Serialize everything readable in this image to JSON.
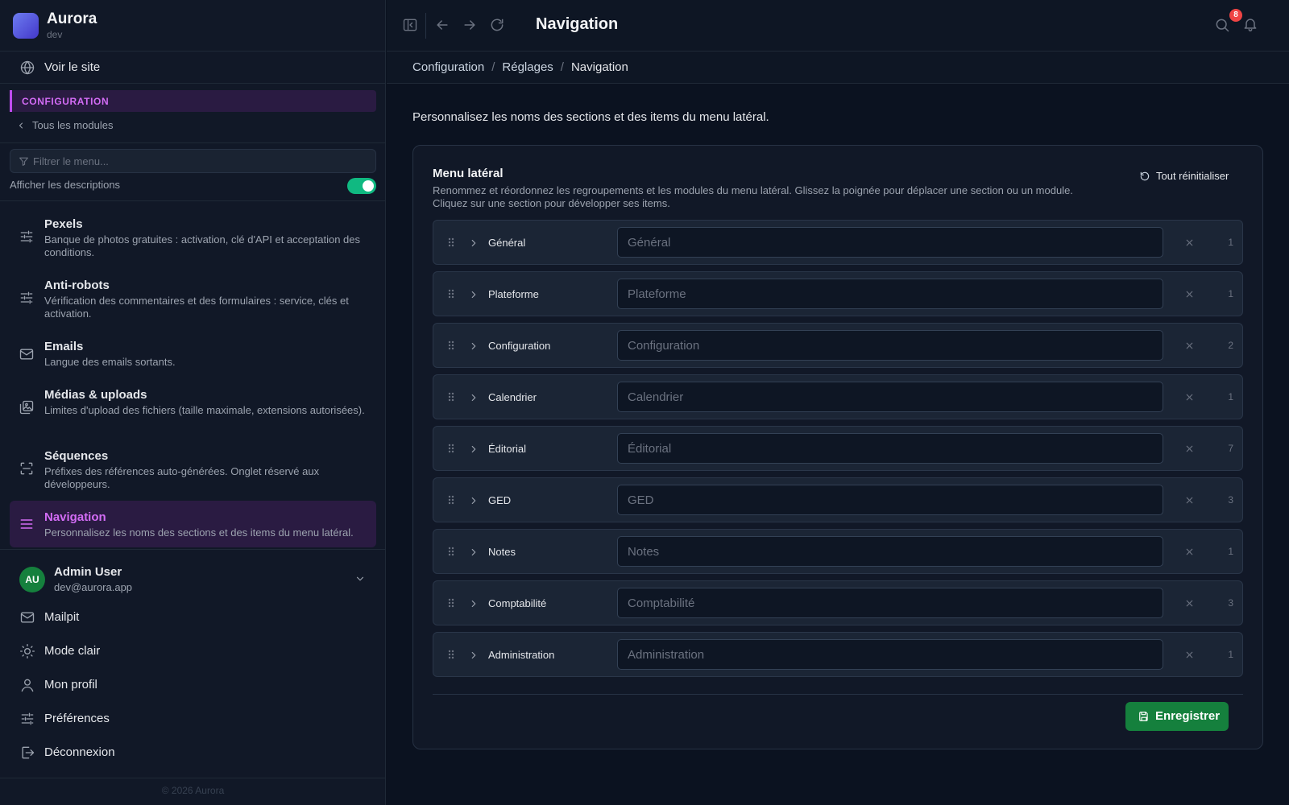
{
  "brand": {
    "name": "Aurora",
    "env": "dev"
  },
  "sidebar": {
    "view_site": "Voir le site",
    "section_title": "CONFIGURATION",
    "all_modules": "Tous les modules",
    "filter_placeholder": "Filtrer le menu...",
    "descriptions_toggle": {
      "label": "Afficher les descriptions",
      "on": true
    },
    "items": [
      {
        "title": "Pexels",
        "desc": "Banque de photos gratuites : activation, clé d'API et acceptation des conditions.",
        "icon": "sliders-icon"
      },
      {
        "title": "Anti-robots",
        "desc": "Vérification des commentaires et des formulaires : service, clés et activation.",
        "icon": "sliders-icon"
      },
      {
        "title": "Emails",
        "desc": "Langue des emails sortants.",
        "icon": "mail-icon"
      },
      {
        "title": "Médias & uploads",
        "desc": "Limites d'upload des fichiers (taille maximale, extensions autorisées).",
        "icon": "images-icon"
      },
      {
        "title": "Séquences",
        "desc": "Préfixes des références auto-générées. Onglet réservé aux développeurs.",
        "icon": "scan-icon"
      },
      {
        "title": "Navigation",
        "desc": "Personnalisez les noms des sections et des items du menu latéral.",
        "icon": "menu-icon",
        "active": true
      }
    ],
    "user": {
      "initials": "AU",
      "name": "Admin User",
      "email": "dev@aurora.app"
    },
    "bottom_items": [
      {
        "label": "Mailpit",
        "icon": "mail-icon"
      },
      {
        "label": "Mode clair",
        "icon": "sun-icon"
      },
      {
        "label": "Mon profil",
        "icon": "user-icon"
      },
      {
        "label": "Préférences",
        "icon": "sliders-icon"
      },
      {
        "label": "Déconnexion",
        "icon": "logout-icon"
      }
    ],
    "copyright": "© 2026 Aurora"
  },
  "header": {
    "title": "Navigation",
    "notifications_count": "8",
    "breadcrumb": [
      "Configuration",
      "Réglages",
      "Navigation"
    ]
  },
  "main": {
    "intro": "Personnalisez les noms des sections et des items du menu latéral.",
    "card": {
      "title": "Menu latéral",
      "description": "Renommez et réordonnez les regroupements et les modules du menu latéral. Glissez la poignée pour déplacer une section ou un module. Cliquez sur une section pour développer ses items.",
      "reset_label": "Tout réinitialiser",
      "save_label": "Enregistrer",
      "sections": [
        {
          "name": "Général",
          "placeholder": "Général",
          "count": "1"
        },
        {
          "name": "Plateforme",
          "placeholder": "Plateforme",
          "count": "1"
        },
        {
          "name": "Configuration",
          "placeholder": "Configuration",
          "count": "2"
        },
        {
          "name": "Calendrier",
          "placeholder": "Calendrier",
          "count": "1"
        },
        {
          "name": "Éditorial",
          "placeholder": "Éditorial",
          "count": "7"
        },
        {
          "name": "GED",
          "placeholder": "GED",
          "count": "3"
        },
        {
          "name": "Notes",
          "placeholder": "Notes",
          "count": "1"
        },
        {
          "name": "Comptabilité",
          "placeholder": "Comptabilité",
          "count": "3"
        },
        {
          "name": "Administration",
          "placeholder": "Administration",
          "count": "1"
        }
      ]
    }
  },
  "colors": {
    "accent": "#c04cf0",
    "success": "#15803d",
    "toggle_on": "#10b981",
    "badge": "#ef4444"
  }
}
